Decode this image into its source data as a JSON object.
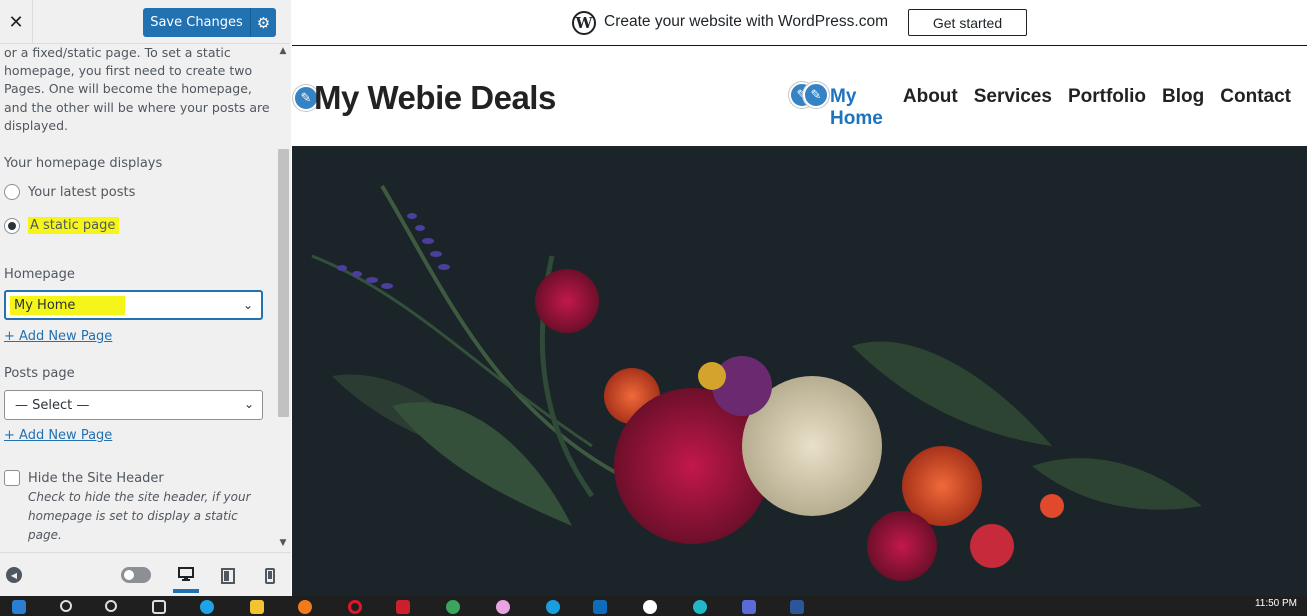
{
  "sidebar": {
    "save_label": "Save Changes",
    "description": "or a fixed/static page. To set a static homepage, you first need to create two Pages. One will become the homepage, and the other will be where your posts are displayed.",
    "homepage_displays_label": "Your homepage displays",
    "options": [
      "Your latest posts",
      "A static page"
    ],
    "homepage_label": "Homepage",
    "homepage_value": "My Home",
    "add_new_page": "+ Add New Page",
    "posts_page_label": "Posts page",
    "posts_page_value": "— Select —",
    "add_new_page_2": "+ Add New Page",
    "hide_header_label": "Hide the Site Header",
    "hide_header_help": "Check to hide the site header, if your homepage is set to display a static page."
  },
  "preview": {
    "wpcom_text": "Create your website with WordPress.com",
    "get_started": "Get started",
    "site_title": "My Webie Deals",
    "nav": [
      "My Home",
      "About",
      "Services",
      "Portfolio",
      "Blog",
      "Contact"
    ]
  },
  "taskbar": {
    "clock": "11:50 PM"
  },
  "colors": {
    "accent": "#2271b1",
    "highlight": "#f5f51a",
    "nav_active": "#1e73be",
    "hero_bg": "#1b2428"
  }
}
